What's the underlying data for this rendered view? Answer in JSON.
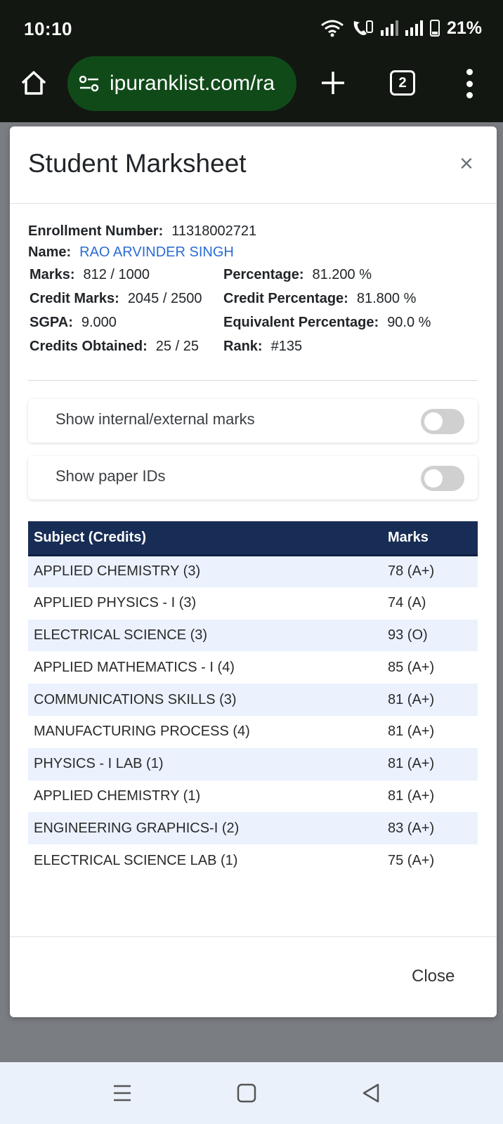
{
  "status_bar": {
    "time": "10:10",
    "battery": "21%"
  },
  "browser": {
    "url": "ipuranklist.com/ra",
    "tab_count": "2"
  },
  "modal": {
    "title": "Student Marksheet",
    "close_x": "×",
    "fields": {
      "enrollment_label": "Enrollment Number:",
      "enrollment_value": "11318002721",
      "name_label": "Name:",
      "name_value": "RAO ARVINDER SINGH",
      "marks_label": "Marks:",
      "marks_value": "812 / 1000",
      "percentage_label": "Percentage:",
      "percentage_value": "81.200 %",
      "credit_marks_label": "Credit Marks:",
      "credit_marks_value": "2045 / 2500",
      "credit_percentage_label": "Credit Percentage:",
      "credit_percentage_value": "81.800 %",
      "sgpa_label": "SGPA:",
      "sgpa_value": "9.000",
      "equivalent_label": "Equivalent Percentage:",
      "equivalent_value": "90.0 %",
      "credits_obtained_label": "Credits Obtained:",
      "credits_obtained_value": "25 / 25",
      "rank_label": "Rank:",
      "rank_value": "#135"
    },
    "toggles": [
      {
        "label": "Show internal/external marks",
        "checked": false
      },
      {
        "label": "Show paper IDs",
        "checked": false
      }
    ],
    "table": {
      "headers": [
        "Subject (Credits)",
        "Marks"
      ],
      "rows": [
        [
          "APPLIED CHEMISTRY (3)",
          "78 (A+)"
        ],
        [
          "APPLIED PHYSICS - I (3)",
          "74 (A)"
        ],
        [
          "ELECTRICAL SCIENCE (3)",
          "93 (O)"
        ],
        [
          "APPLIED MATHEMATICS - I (4)",
          "85 (A+)"
        ],
        [
          "COMMUNICATIONS SKILLS (3)",
          "81 (A+)"
        ],
        [
          "MANUFACTURING PROCESS (4)",
          "81 (A+)"
        ],
        [
          "PHYSICS - I LAB (1)",
          "81 (A+)"
        ],
        [
          "APPLIED CHEMISTRY (1)",
          "81 (A+)"
        ],
        [
          "ENGINEERING GRAPHICS-I (2)",
          "83 (A+)"
        ],
        [
          "ELECTRICAL SCIENCE LAB (1)",
          "75 (A+)"
        ]
      ]
    },
    "close_button": "Close"
  },
  "colors": {
    "header_bg": "#182d55",
    "row_shade": "#ebf2fe",
    "name_link": "#2b6cd4",
    "url_pill": "#114a19"
  }
}
